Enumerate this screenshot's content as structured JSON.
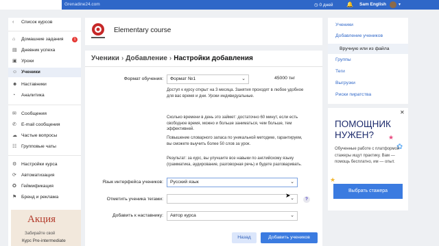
{
  "topbar": {
    "site": "Grenadine24.com",
    "days": "0 дней",
    "user": "Sam English"
  },
  "sidebar": {
    "back": "Список курсов",
    "items": [
      {
        "label": "Домашние задания",
        "icon": "home-icon",
        "badge": "1"
      },
      {
        "label": "Дневник успеха",
        "icon": "diary-icon"
      },
      {
        "label": "Уроки",
        "icon": "lessons-icon"
      },
      {
        "label": "Ученики",
        "icon": "students-icon",
        "active": true
      },
      {
        "label": "Наставники",
        "icon": "mentors-icon"
      },
      {
        "label": "Аналитика",
        "icon": "analytics-icon"
      },
      {
        "label": "Сообщения",
        "icon": "messages-icon"
      },
      {
        "label": "E-mail сообщения",
        "icon": "email-icon"
      },
      {
        "label": "Частые вопросы",
        "icon": "faq-icon"
      },
      {
        "label": "Групповые чаты",
        "icon": "chats-icon"
      },
      {
        "label": "Настройки курса",
        "icon": "settings-icon"
      },
      {
        "label": "Автоматизация",
        "icon": "automation-icon"
      },
      {
        "label": "Геймификация",
        "icon": "gamification-icon"
      },
      {
        "label": "Бренд и реклама",
        "icon": "brand-icon"
      }
    ],
    "promo": {
      "title": "Акция",
      "subtitle": "Забирайте свой",
      "course": "Курс Pre-intermediate"
    }
  },
  "course": {
    "name": "Elementary course"
  },
  "breadcrumb": {
    "part1": "Ученики",
    "part2": "Добавление",
    "part3": "Настройки добавления"
  },
  "form": {
    "format_label": "Формат обучения:",
    "format_value": "Формат №1",
    "price": "45000 тнг",
    "para1": "Доступ к курсу открыт на 3 месяца. Занятия проходят в любое удобное для вас время и дни. Уроки индивидуальные.",
    "para2": "Сколько времени в день это займет: достаточно 60 минут, если есть свободное время, можно и больше заниматься, чем больше, тем эффективней.",
    "para3": "Повышение словарного запаса по уникальной методике, гарантируем, вы сможете выучить более 50 слов за урок.",
    "para4": "Результат: за курс, вы улучшите все навыки по английскому языку (грамматика, аудирование, разговорная речь) и будете разговаривать.",
    "lang_label": "Язык интерфейса учеников:",
    "lang_value": "Русский язык",
    "tags_label": "Отметить ученика тегами:",
    "tags_value": "",
    "mentor_label": "Добавить к наставнику:",
    "mentor_value": "Автор курса",
    "help_icon": "?",
    "back_button": "Назад",
    "add_button": "Добавить учеников"
  },
  "rightnav": {
    "items": [
      "Ученики",
      "Добавление учеников"
    ],
    "sub_item": "Вручную или из файла",
    "items2": [
      "Группы",
      "Теги",
      "Выгрузки",
      "Риски пиратства"
    ]
  },
  "helper": {
    "title_line1": "ПОМОЩНИК",
    "title_line2": "НУЖЕН?",
    "description": "Обученные работе с платформой стажеры ищут практику. Вам — помощь бесплатно, им — опыт.",
    "cta": "Выбрать стажера"
  },
  "colors": {
    "topbar": "#2f67c8",
    "primary_button": "#3b7be0",
    "badge": "#e53935",
    "link": "#2f67c8"
  }
}
